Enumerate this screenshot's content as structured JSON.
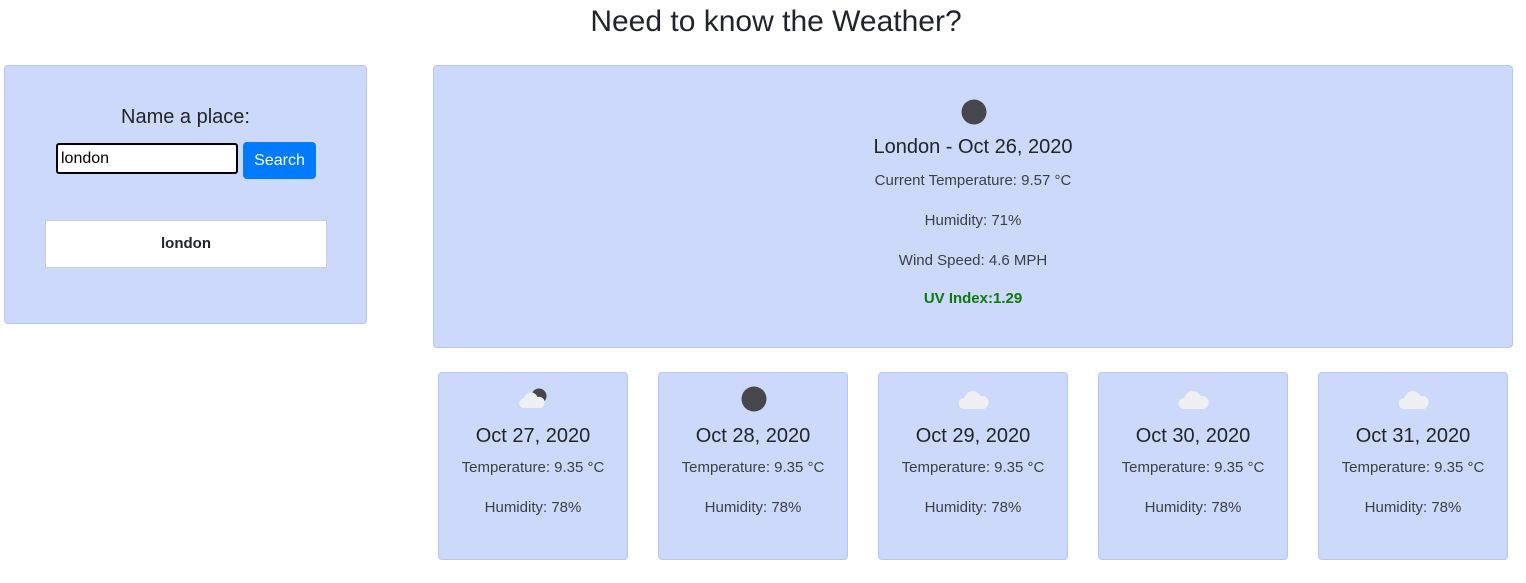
{
  "header": {
    "title": "Need to know the Weather?"
  },
  "search": {
    "label": "Name a place:",
    "input_value": "london",
    "button_label": "Search"
  },
  "history": [
    {
      "label": "london"
    }
  ],
  "current": {
    "icon": "moon-icon",
    "heading": "London - Oct 26, 2020",
    "temperature": "Current Temperature: 9.57 °C",
    "humidity": "Humidity: 71%",
    "wind": "Wind Speed: 4.6 MPH",
    "uv": "UV Index:1.29",
    "uv_color": "#0a7a0a"
  },
  "forecast": [
    {
      "icon": "cloud-moon-icon",
      "date": "Oct 27, 2020",
      "temperature": "Temperature: 9.35 °C",
      "humidity": "Humidity: 78%"
    },
    {
      "icon": "moon-icon",
      "date": "Oct 28, 2020",
      "temperature": "Temperature: 9.35 °C",
      "humidity": "Humidity: 78%"
    },
    {
      "icon": "cloud-icon",
      "date": "Oct 29, 2020",
      "temperature": "Temperature: 9.35 °C",
      "humidity": "Humidity: 78%"
    },
    {
      "icon": "cloud-icon",
      "date": "Oct 30, 2020",
      "temperature": "Temperature: 9.35 °C",
      "humidity": "Humidity: 78%"
    },
    {
      "icon": "cloud-icon",
      "date": "Oct 31, 2020",
      "temperature": "Temperature: 9.35 °C",
      "humidity": "Humidity: 78%"
    }
  ],
  "colors": {
    "panel_bg": "#cdd9fb",
    "button_bg": "#007bff",
    "uv_low": "#0a7a0a"
  }
}
